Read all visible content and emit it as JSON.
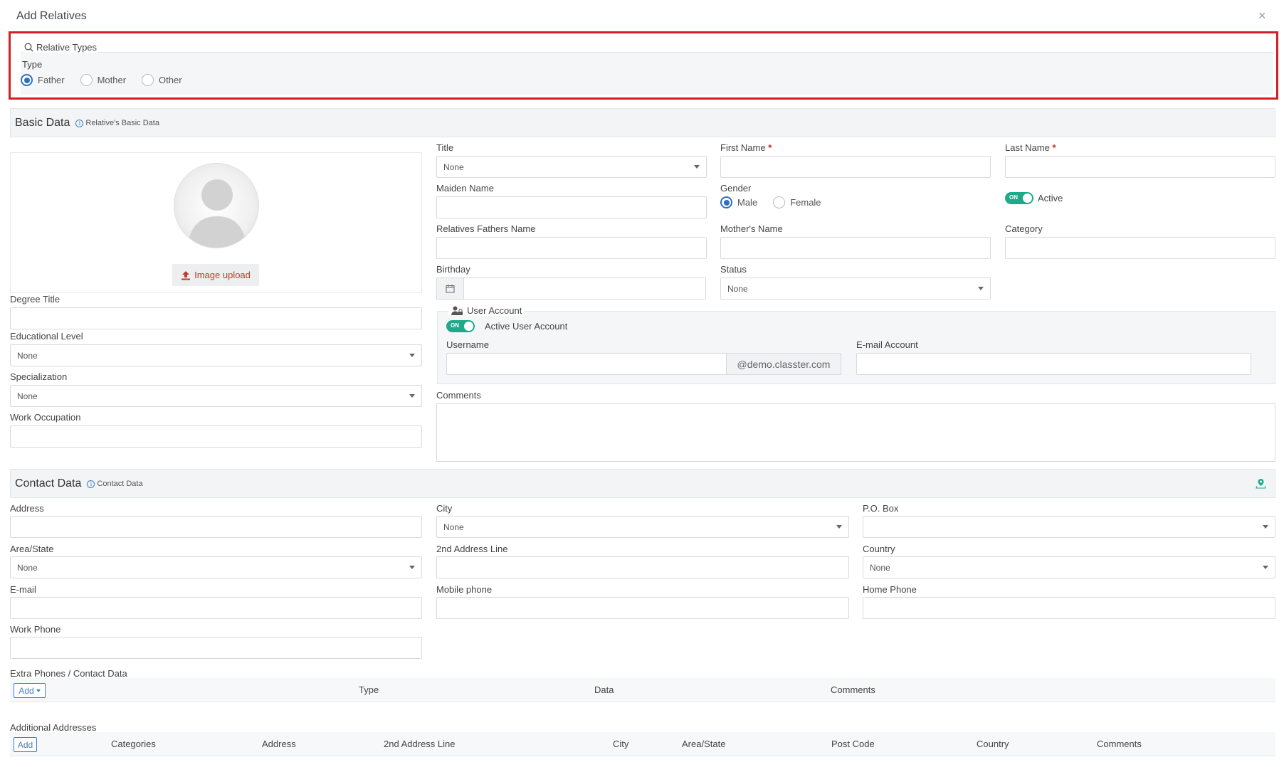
{
  "modal": {
    "title": "Add Relatives",
    "close_glyph": "×"
  },
  "relative_types": {
    "legend": "Relative Types",
    "type_label": "Type",
    "options": [
      {
        "label": "Father",
        "checked": true
      },
      {
        "label": "Mother",
        "checked": false
      },
      {
        "label": "Other",
        "checked": false
      }
    ]
  },
  "basic_data": {
    "title": "Basic Data",
    "subtitle": "Relative's Basic Data",
    "image_upload_label": "Image upload",
    "fields": {
      "title_label": "Title",
      "title_value": "None",
      "first_name_label": "First Name",
      "last_name_label": "Last Name",
      "maiden_name_label": "Maiden Name",
      "gender_label": "Gender",
      "gender_male": "Male",
      "gender_female": "Female",
      "active_toggle": "ON",
      "active_label": "Active",
      "fathers_name_label": "Relatives Fathers Name",
      "mothers_name_label": "Mother's Name",
      "category_label": "Category",
      "birthday_label": "Birthday",
      "status_label": "Status",
      "status_value": "None",
      "degree_title_label": "Degree Title",
      "educational_level_label": "Educational Level",
      "educational_level_value": "None",
      "specialization_label": "Specialization",
      "specialization_value": "None",
      "work_occupation_label": "Work Occupation",
      "comments_label": "Comments"
    },
    "user_account": {
      "legend": "User Account",
      "toggle": "ON",
      "active_label": "Active User Account",
      "username_label": "Username",
      "username_suffix": "@demo.classter.com",
      "email_account_label": "E-mail Account"
    },
    "required_marker": "*"
  },
  "contact_data": {
    "title": "Contact Data",
    "subtitle": "Contact Data",
    "fields": {
      "address_label": "Address",
      "city_label": "City",
      "city_value": "None",
      "po_box_label": "P.O. Box",
      "area_label": "Area/State",
      "area_value": "None",
      "address2_label": "2nd Address Line",
      "country_label": "Country",
      "country_value": "None",
      "email_label": "E-mail",
      "mobile_label": "Mobile phone",
      "home_phone_label": "Home Phone",
      "work_phone_label": "Work Phone"
    }
  },
  "extra_phones": {
    "label": "Extra Phones / Contact Data",
    "add_label": "Add",
    "columns": [
      "Type",
      "Data",
      "Comments"
    ]
  },
  "additional_addresses": {
    "label": "Additional Addresses",
    "add_label": "Add",
    "columns": [
      "Categories",
      "Address",
      "2nd Address Line",
      "City",
      "Area/State",
      "Post Code",
      "Country",
      "Comments"
    ]
  },
  "icons": {
    "search": "search-icon",
    "info": "info-icon",
    "calendar": "calendar-icon",
    "user_account": "user-lock-icon",
    "upload": "upload-icon",
    "map_pin": "map-pin-icon",
    "close": "close-icon"
  },
  "colors": {
    "accent": "#2f6fbf",
    "toggle_on": "#1fa98b",
    "required": "#d21f26",
    "highlight_border": "#d21f26"
  }
}
